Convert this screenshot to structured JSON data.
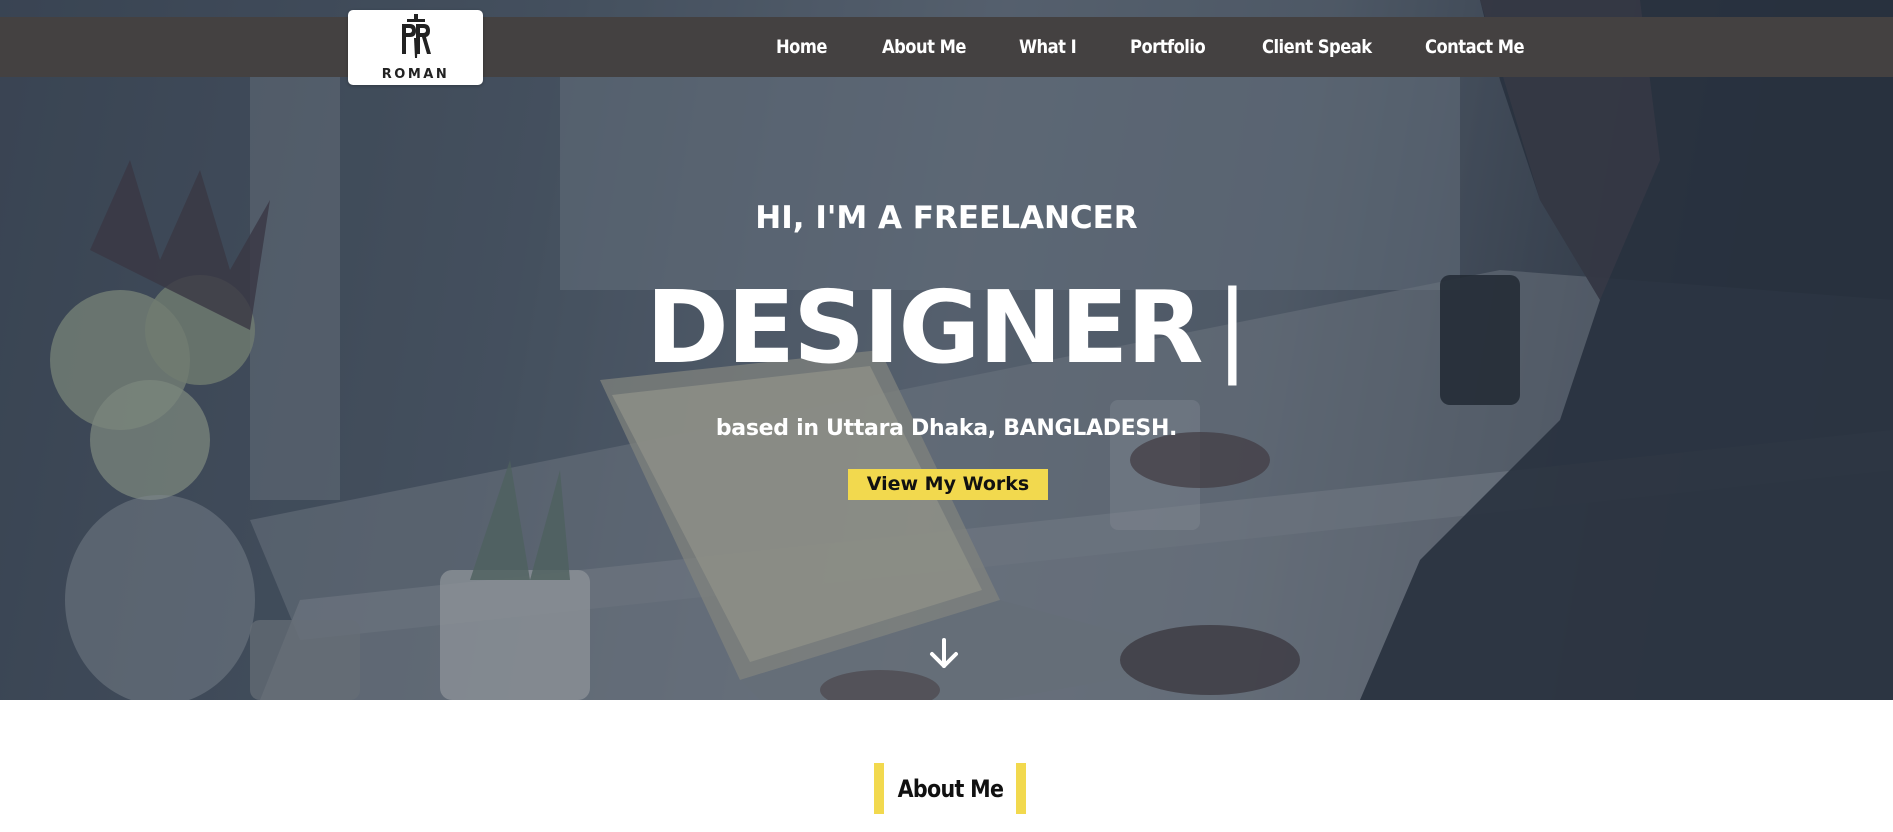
{
  "logo": {
    "text": "ROMAN",
    "icon": "sword-monogram-logo"
  },
  "nav": {
    "items": [
      {
        "label": "Home"
      },
      {
        "label": "About Me"
      },
      {
        "label": "What I"
      },
      {
        "label": "Portfolio"
      },
      {
        "label": "Client Speak"
      },
      {
        "label": "Contact Me"
      }
    ]
  },
  "hero": {
    "intro": "HI, I'M A FREELANCER",
    "headline": "DESIGNER",
    "cursor": "|",
    "location": "based in Uttara Dhaka, BANGLADESH.",
    "cta_label": "View My Works",
    "scroll_icon": "arrow-down-icon"
  },
  "about": {
    "heading": "About Me"
  },
  "colors": {
    "navbar": "#444141",
    "accent": "#f2d94e",
    "hero_text": "#ffffff"
  }
}
